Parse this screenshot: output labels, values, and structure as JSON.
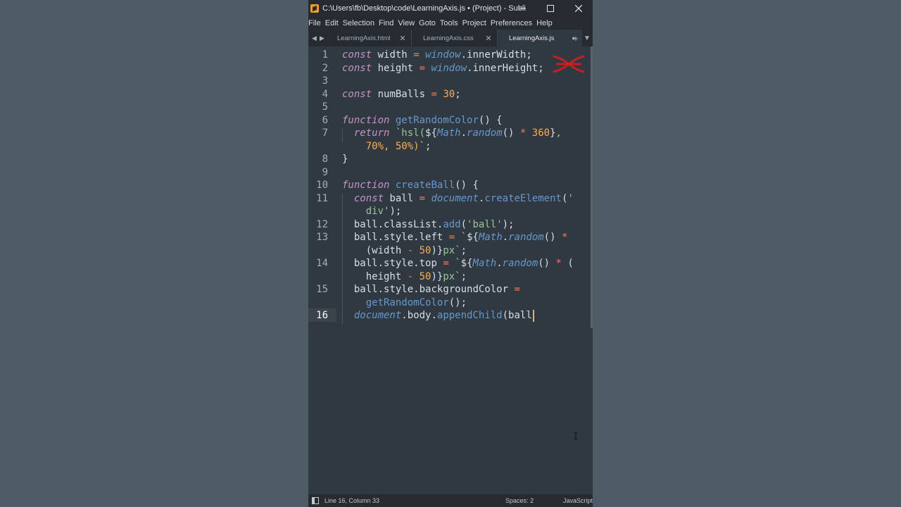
{
  "window": {
    "title": "C:\\Users\\fb\\Desktop\\code\\LearningAxis.js • (Project) - Subli...",
    "controls": {
      "minimize": "–",
      "maximize": "☐",
      "close": "✕"
    }
  },
  "menu": [
    "File",
    "Edit",
    "Selection",
    "Find",
    "View",
    "Goto",
    "Tools",
    "Project",
    "Preferences",
    "Help"
  ],
  "tabs": {
    "nav_prev": "◀",
    "nav_next": "▶",
    "items": [
      {
        "label": "LearningAxis.html",
        "close": "✕"
      },
      {
        "label": "LearningAxis.css",
        "close": "✕"
      },
      {
        "label": "LearningAxis.js",
        "close": "●"
      }
    ],
    "new_tab": "+",
    "dropdown": "▼"
  },
  "editor": {
    "line_numbers": [
      "1",
      "2",
      "3",
      "4",
      "5",
      "6",
      "7",
      "8",
      "9",
      "10",
      "11",
      "12",
      "13",
      "14",
      "15",
      "16"
    ],
    "active_line": "16",
    "colors": {
      "background": "#303841",
      "keyword": "#c594c5",
      "function": "#6699cc",
      "string": "#99c794",
      "number": "#f9ae58",
      "operator": "#f97b58"
    }
  },
  "status": {
    "position": "Line 16, Column 33",
    "spaces": "Spaces: 2",
    "syntax": "JavaScript"
  }
}
